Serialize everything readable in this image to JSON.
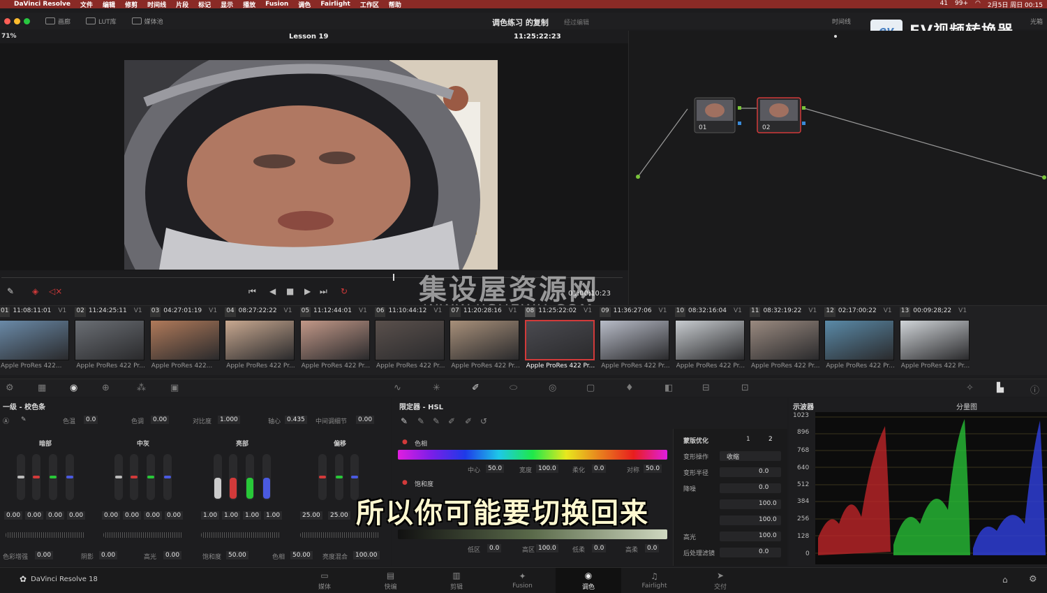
{
  "menubar": {
    "app": "DaVinci Resolve",
    "items": [
      "文件",
      "编辑",
      "修剪",
      "时间线",
      "片段",
      "标记",
      "显示",
      "播放",
      "Fusion",
      "调色",
      "Fairlight",
      "工作区",
      "帮助"
    ],
    "status": [
      "41",
      "99+",
      "2月5日 周日 00:15"
    ]
  },
  "toolbar": {
    "gallery": "画廊",
    "lut": "LUT库",
    "media": "媒体池",
    "project_title": "调色练习 的复制",
    "project_sub": "经过编辑",
    "timeline": "时间线",
    "clips": "片段",
    "lightbox": "光箱"
  },
  "watermark": {
    "ev_logo": "ev",
    "ev_text": "EV视频转换器",
    "site_cn": "集设屋资源网",
    "site_url": "WWW.JISHEWU.COM"
  },
  "viewer": {
    "zoom": "71%",
    "clip_name": "Lesson 19",
    "timecode": "11:25:22:23",
    "playhead_fraction": 0.63,
    "transport_timecode": "01:00:10:23"
  },
  "nodes": [
    {
      "label": "01"
    },
    {
      "label": "02"
    }
  ],
  "clips": [
    {
      "num": "01",
      "tc": "11:08:11:01",
      "track": "V1",
      "name": "Apple ProRes 422..."
    },
    {
      "num": "02",
      "tc": "11:24:25:11",
      "track": "V1",
      "name": "Apple ProRes 422 Pr..."
    },
    {
      "num": "03",
      "tc": "04:27:01:19",
      "track": "V1",
      "name": "Apple ProRes 422..."
    },
    {
      "num": "04",
      "tc": "08:27:22:22",
      "track": "V1",
      "name": "Apple ProRes 422 Pr..."
    },
    {
      "num": "05",
      "tc": "11:12:44:01",
      "track": "V1",
      "name": "Apple ProRes 422 Pr..."
    },
    {
      "num": "06",
      "tc": "11:10:44:12",
      "track": "V1",
      "name": "Apple ProRes 422 Pr..."
    },
    {
      "num": "07",
      "tc": "11:20:28:16",
      "track": "V1",
      "name": "Apple ProRes 422 Pr..."
    },
    {
      "num": "08",
      "tc": "11:25:22:02",
      "track": "V1",
      "name": "Apple ProRes 422 Pr..."
    },
    {
      "num": "09",
      "tc": "11:36:27:06",
      "track": "V1",
      "name": "Apple ProRes 422 Pr..."
    },
    {
      "num": "10",
      "tc": "08:32:16:04",
      "track": "V1",
      "name": "Apple ProRes 422 Pr..."
    },
    {
      "num": "11",
      "tc": "08:32:19:22",
      "track": "V1",
      "name": "Apple ProRes 422 Pr..."
    },
    {
      "num": "12",
      "tc": "02:17:00:22",
      "track": "V1",
      "name": "Apple ProRes 422 Pr..."
    },
    {
      "num": "13",
      "tc": "00:09:28;22",
      "track": "V1",
      "name": "Apple ProRes 422 Pr..."
    }
  ],
  "primary": {
    "title": "一级 - 校色条",
    "temp_label": "色温",
    "temp": "0.0",
    "tint_label": "色调",
    "tint": "0.00",
    "contrast_label": "对比度",
    "contrast": "1.000",
    "pivot_label": "轴心",
    "pivot": "0.435",
    "middetail_label": "中间调细节",
    "middetail": "0.00",
    "wheels": [
      {
        "name": "暗部",
        "values": [
          "0.00",
          "0.00",
          "0.00",
          "0.00"
        ]
      },
      {
        "name": "中灰",
        "values": [
          "0.00",
          "0.00",
          "0.00",
          "0.00"
        ]
      },
      {
        "name": "亮部",
        "values": [
          "1.00",
          "1.00",
          "1.00",
          "1.00"
        ]
      },
      {
        "name": "偏移",
        "values": [
          "25.00",
          "25.00"
        ]
      }
    ],
    "bottom": [
      {
        "label": "色彩增强",
        "value": "0.00"
      },
      {
        "label": "阴影",
        "value": "0.00"
      },
      {
        "label": "高光",
        "value": "0.00"
      },
      {
        "label": "饱和度",
        "value": "50.00"
      },
      {
        "label": "色相",
        "value": "50.00"
      },
      {
        "label": "亮度混合",
        "value": "100.00"
      }
    ]
  },
  "hsl": {
    "title": "限定器 - HSL",
    "hue_label": "色相",
    "hue_params": [
      {
        "label": "中心",
        "value": "50.0"
      },
      {
        "label": "宽度",
        "value": "100.0"
      },
      {
        "label": "柔化",
        "value": "0.0"
      },
      {
        "label": "对称",
        "value": "50.0"
      }
    ],
    "sat_label": "饱和度",
    "sat_params": [
      {
        "label": "低区",
        "value": "0.0"
      },
      {
        "label": "高区",
        "value": "100.0"
      },
      {
        "label": "低柔",
        "value": "0.0"
      },
      {
        "label": "高柔",
        "value": "0.0"
      }
    ],
    "matte_title": "蒙版优化",
    "matte_tabs": [
      "1",
      "2"
    ],
    "matte_rows": [
      {
        "label": "变形操作",
        "value": "收缩"
      },
      {
        "label": "变形半径",
        "value": "0.0"
      },
      {
        "label": "降噪",
        "value": "0.0"
      },
      {
        "label": "",
        "value": "100.0"
      },
      {
        "label": "",
        "value": "100.0"
      },
      {
        "label": "高光",
        "value": "100.0"
      },
      {
        "label": "后处理滤镜",
        "value": "0.0"
      }
    ]
  },
  "subtitle": "所以你可能要切换回来",
  "scope": {
    "title": "示波器",
    "mode": "分量图",
    "ticks": [
      "1023",
      "896",
      "768",
      "640",
      "512",
      "384",
      "256",
      "128",
      "0"
    ]
  },
  "nav": [
    {
      "label": "媒体",
      "icon": "▭"
    },
    {
      "label": "快编",
      "icon": "▤"
    },
    {
      "label": "剪辑",
      "icon": "▥"
    },
    {
      "label": "Fusion",
      "icon": "✦"
    },
    {
      "label": "调色",
      "icon": "◉"
    },
    {
      "label": "Fairlight",
      "icon": "♫"
    },
    {
      "label": "交付",
      "icon": "➤"
    }
  ],
  "brand": "DaVinci Resolve 18",
  "colors": {
    "accent_red": "#d23a3a",
    "menubar": "#8a2a26"
  }
}
